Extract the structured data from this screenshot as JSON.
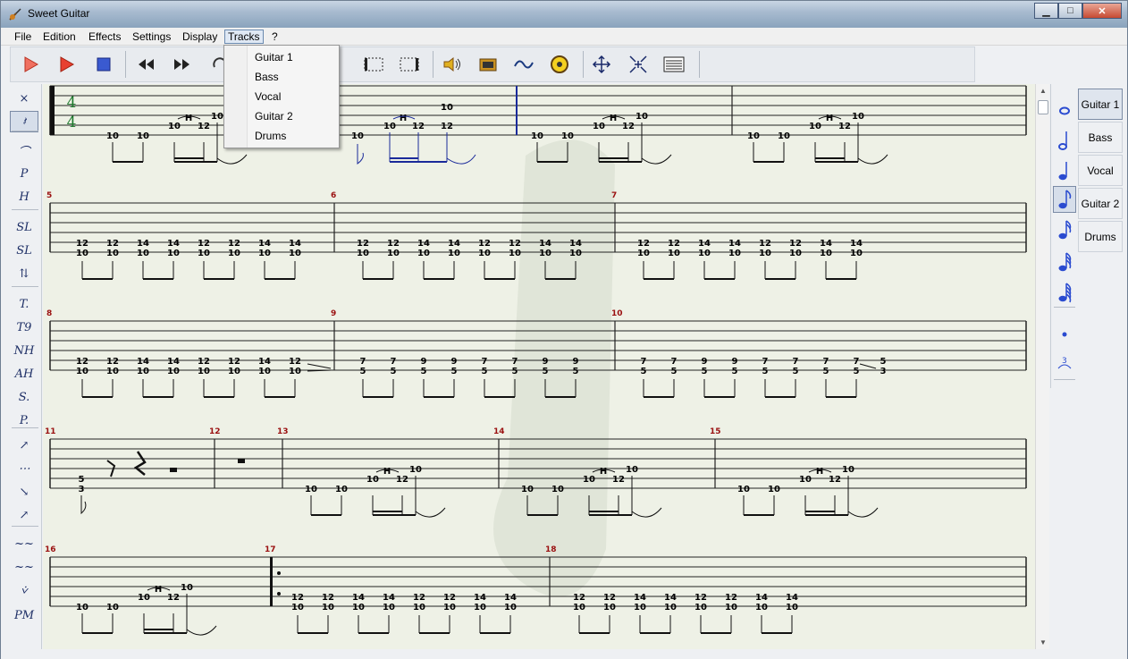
{
  "window": {
    "title": "Sweet Guitar"
  },
  "menubar": [
    {
      "label": "File"
    },
    {
      "label": "Edition"
    },
    {
      "label": "Effects"
    },
    {
      "label": "Settings"
    },
    {
      "label": "Display"
    },
    {
      "label": "Tracks"
    },
    {
      "label": "?"
    }
  ],
  "tracks_menu": [
    "Guitar 1",
    "Bass",
    "Vocal",
    "Guitar 2",
    "Drums"
  ],
  "toolbar": [
    {
      "icon": "play-icon"
    },
    {
      "icon": "play-selection-icon"
    },
    {
      "icon": "stop-icon"
    },
    {
      "icon": "rewind-icon"
    },
    {
      "icon": "fast-forward-icon"
    },
    {
      "icon": "loop-icon"
    },
    {
      "icon": "repeat-start-icon"
    },
    {
      "icon": "repeat-end-icon"
    },
    {
      "icon": "speaker-icon"
    },
    {
      "icon": "amplifier-icon"
    },
    {
      "icon": "wave-icon"
    },
    {
      "icon": "tuner-icon"
    },
    {
      "icon": "move-icon"
    },
    {
      "icon": "shrink-icon"
    },
    {
      "icon": "list-icon"
    }
  ],
  "left_tools": [
    "×",
    "𝄽",
    "⌒",
    "P",
    "H",
    "SL",
    "SL",
    "⇅",
    "T.",
    "T9",
    "NH",
    "AH",
    "S.",
    "P.",
    "↗",
    "⋯",
    "↘",
    "↗",
    "~~",
    "~~",
    "⩒",
    "PM"
  ],
  "track_tabs": [
    "Guitar 1",
    "Bass",
    "Vocal",
    "Guitar 2",
    "Drums"
  ],
  "score": {
    "time_signature": [
      "4",
      "4"
    ],
    "systems": [
      {
        "measures": [
          {
            "num": "",
            "notes": [
              [
                "10"
              ],
              [
                "10"
              ],
              [
                "10",
                "H",
                "12"
              ],
              [
                "12"
              ],
              [
                "10"
              ]
            ]
          },
          {
            "num": "",
            "notes": [
              [
                "10"
              ],
              [
                "10",
                "H",
                "12"
              ],
              [
                "12"
              ],
              [
                "10",
                "12"
              ]
            ]
          },
          {
            "num": "",
            "notes": [
              [
                "10"
              ],
              [
                "10"
              ],
              [
                "10",
                "H",
                "12"
              ],
              [
                "12"
              ],
              [
                "10"
              ]
            ]
          },
          {
            "num": "",
            "notes": [
              [
                "10"
              ],
              [
                "10"
              ],
              [
                "10",
                "H",
                "12"
              ],
              [
                "12"
              ],
              [
                "10"
              ]
            ]
          }
        ]
      }
    ],
    "measure_numbers": [
      "5",
      "6",
      "7",
      "8",
      "9",
      "10",
      "11",
      "12",
      "13",
      "14",
      "15",
      "16",
      "17",
      "18"
    ],
    "notes": {
      "ten": "10",
      "twelve": "12",
      "fourteen": "14",
      "seven": "7",
      "nine": "9",
      "five": "5",
      "three": "3",
      "hammer": "H"
    }
  },
  "colors": {
    "staff": "#111111",
    "selected": "#1a2a9a",
    "measure_number": "#9a1010",
    "accent_blue": "#2a4bd0"
  }
}
